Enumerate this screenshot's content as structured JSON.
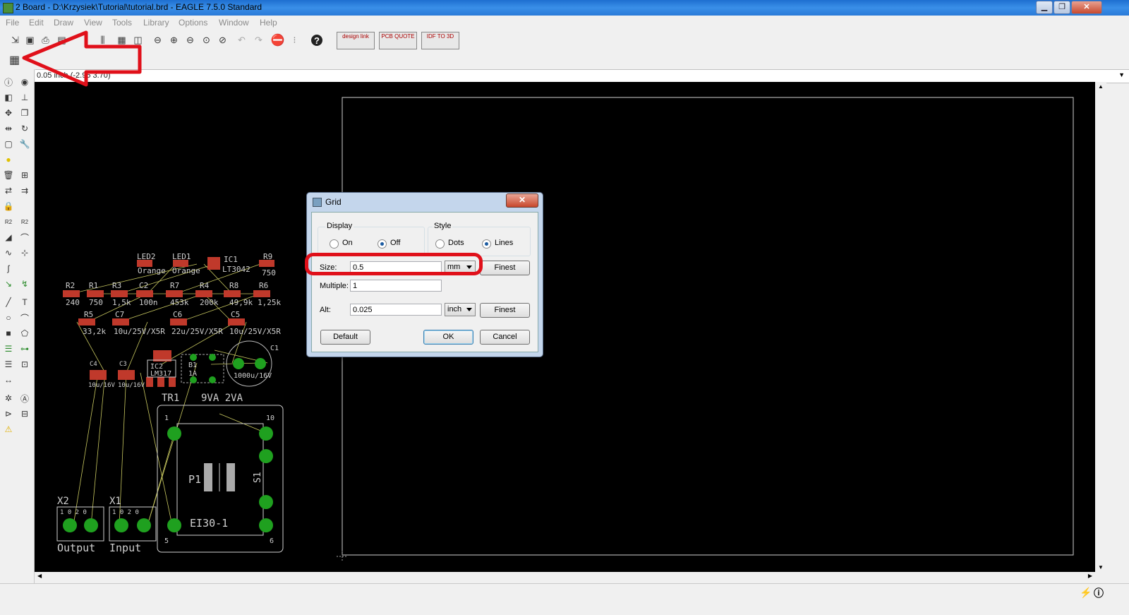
{
  "window": {
    "title": "2 Board - D:\\Krzysiek\\Tutorial\\tutorial.brd - EAGLE 7.5.0 Standard",
    "min_symbol": "▁",
    "max_symbol": "❐",
    "close_symbol": "✕"
  },
  "menu": [
    "File",
    "Edit",
    "Draw",
    "View",
    "Tools",
    "Library",
    "Options",
    "Window",
    "Help"
  ],
  "toolbar": {
    "design_link": "design link",
    "pcb_quote": "PCB QUOTE",
    "idf_to_3d": "IDF TO 3D",
    "help_glyph": "?"
  },
  "coord_readout": "0.05 inch (-2.95 3.70)",
  "dialog": {
    "title": "Grid",
    "close": "✕",
    "display": {
      "label": "Display",
      "on": "On",
      "off": "Off",
      "selected": "Off"
    },
    "style": {
      "label": "Style",
      "dots": "Dots",
      "lines": "Lines",
      "selected": "Lines"
    },
    "size": {
      "label": "Size:",
      "value": "0.5",
      "unit": "mm",
      "finest": "Finest"
    },
    "multiple": {
      "label": "Multiple:",
      "value": "1"
    },
    "alt": {
      "label": "Alt:",
      "value": "0.025",
      "unit": "inch",
      "finest": "Finest"
    },
    "buttons": {
      "default": "Default",
      "ok": "OK",
      "cancel": "Cancel"
    }
  },
  "board": {
    "parts_top": [
      "LED2",
      "LED1",
      "IC1",
      "R9"
    ],
    "values_top": [
      "Orange",
      "Orange",
      "LT3042",
      "750"
    ],
    "resistors_row": [
      "R2",
      "R1",
      "R3",
      "C2",
      "R7",
      "R4",
      "R8",
      "R6"
    ],
    "resistor_values": [
      "240",
      "750",
      "1,5k",
      "100n",
      "453k",
      "200k",
      "49,9k",
      "1,25k"
    ],
    "caps_row": [
      "R5",
      "C7",
      "C6",
      "C5"
    ],
    "caps_values": [
      "33,2k",
      "10u/25V/X5R",
      "22u/25V/X5R",
      "10u/25V/X5R"
    ],
    "lower_parts": [
      "C4",
      "C3",
      "IC2",
      "B1",
      "C1"
    ],
    "lower_values": [
      "10u/16V",
      "10u/16V",
      "LM317",
      "1A",
      "1000u/16V"
    ],
    "transformer": {
      "name": "TR1",
      "value": "9VA 2VA",
      "type": "EI30-1",
      "pin1": "1",
      "pin10": "10",
      "pin5": "5",
      "pin6": "6"
    },
    "p1": "P1",
    "s1": "S1",
    "x2": {
      "name": "X2",
      "label": "Output",
      "pins": "1 0  2 0"
    },
    "x1": {
      "name": "X1",
      "label": "Input",
      "pins": "1 0  2 0"
    }
  },
  "colors": {
    "pad_green": "#1fa01f",
    "smd_red": "#c0392b",
    "airwire": "#c8c860",
    "annotation_red": "#e0101a",
    "canvas": "#000000"
  }
}
